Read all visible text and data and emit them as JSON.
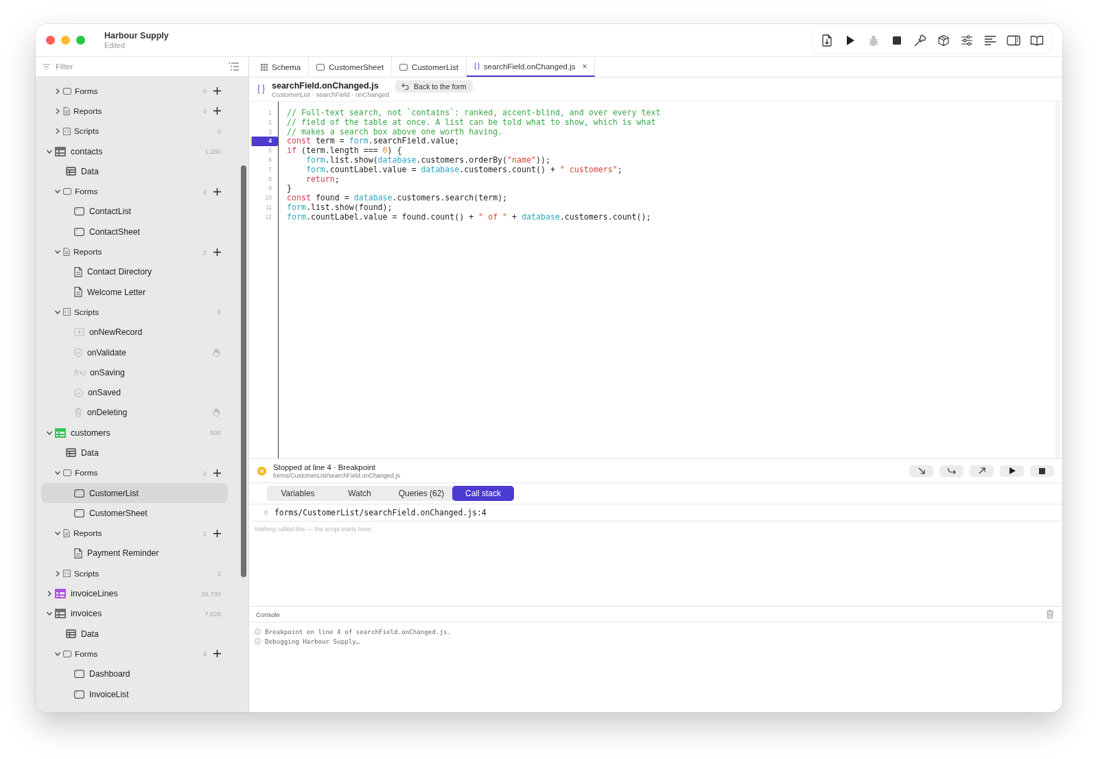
{
  "window": {
    "title": "Harbour Supply",
    "subtitle": "Edited"
  },
  "sidebar": {
    "filter": {
      "placeholder": "Filter"
    },
    "items": [
      {
        "kind": "forms",
        "label": "Forms",
        "count": "0",
        "expanded": false,
        "selected": false
      },
      {
        "kind": "reports",
        "label": "Reports",
        "count": "0",
        "expanded": false,
        "selected": false
      },
      {
        "kind": "scripts",
        "label": "Scripts",
        "count": "0",
        "expanded": false,
        "selected": false
      },
      {
        "kind": "table",
        "label": "contacts",
        "count": "1.280",
        "color": "#6e6e73",
        "expanded": true,
        "selected": false,
        "children": [
          {
            "kind": "data",
            "label": "Data",
            "selected": false
          },
          {
            "kind": "forms",
            "label": "Forms",
            "count": "2",
            "expanded": true,
            "selected": false,
            "children": [
              {
                "kind": "form",
                "label": "ContactList",
                "selected": false
              },
              {
                "kind": "form",
                "label": "ContactSheet",
                "selected": false
              }
            ]
          },
          {
            "kind": "reports",
            "label": "Reports",
            "count": "2",
            "expanded": true,
            "selected": false,
            "children": [
              {
                "kind": "report",
                "label": "Contact Directory",
                "selected": false
              },
              {
                "kind": "report",
                "label": "Welcome Letter",
                "selected": false
              }
            ]
          },
          {
            "kind": "scripts",
            "label": "Scripts",
            "count": "0",
            "expanded": true,
            "selected": false,
            "children": [
              {
                "kind": "insert",
                "label": "onNewRecord",
                "hand": false,
                "selected": false
              },
              {
                "kind": "validate",
                "label": "onValidate",
                "hand": true,
                "selected": false
              },
              {
                "kind": "formula",
                "glyph": "f(x)",
                "label": "onSaving",
                "hand": false,
                "selected": false
              },
              {
                "kind": "saved",
                "label": "onSaved",
                "hand": false,
                "selected": false
              },
              {
                "kind": "delete",
                "label": "onDeleting",
                "hand": true,
                "selected": false
              }
            ]
          }
        ]
      },
      {
        "kind": "table",
        "label": "customers",
        "count": "500",
        "color": "#34c759",
        "expanded": true,
        "selected": false,
        "children": [
          {
            "kind": "data",
            "label": "Data",
            "selected": false
          },
          {
            "kind": "forms",
            "label": "Forms",
            "count": "2",
            "expanded": true,
            "selected": false,
            "children": [
              {
                "kind": "form",
                "label": "CustomerList",
                "selected": true
              },
              {
                "kind": "form",
                "label": "CustomerSheet",
                "selected": false
              }
            ]
          },
          {
            "kind": "reports",
            "label": "Reports",
            "count": "1",
            "expanded": true,
            "selected": false,
            "children": [
              {
                "kind": "report",
                "label": "Payment Reminder",
                "selected": false
              }
            ]
          },
          {
            "kind": "scripts",
            "label": "Scripts",
            "count": "2",
            "expanded": false,
            "selected": false
          }
        ]
      },
      {
        "kind": "table",
        "label": "invoiceLines",
        "count": "26.730",
        "color": "#af52de",
        "expanded": false,
        "selected": false
      },
      {
        "kind": "table",
        "label": "invoices",
        "count": "7.628",
        "color": "#6e6e73",
        "expanded": true,
        "selected": false,
        "children": [
          {
            "kind": "data",
            "label": "Data",
            "selected": false
          },
          {
            "kind": "forms",
            "label": "Forms",
            "count": "3",
            "expanded": true,
            "selected": false,
            "children": [
              {
                "kind": "form",
                "label": "Dashboard",
                "selected": false
              },
              {
                "kind": "form",
                "label": "InvoiceList",
                "selected": false
              }
            ]
          }
        ]
      }
    ]
  },
  "tabs": [
    {
      "kind": "schema",
      "label": "Schema",
      "selected": false
    },
    {
      "kind": "form",
      "label": "CustomerSheet",
      "selected": false
    },
    {
      "kind": "form",
      "label": "CustomerList",
      "selected": false
    },
    {
      "kind": "script",
      "label": "searchField.onChanged.js",
      "close": "×",
      "selected": true
    }
  ],
  "editor": {
    "title": "searchField.onChanged.js",
    "subtitle": "CustomerList · searchField · onChanged",
    "back_button": "Back to the form",
    "lines": [
      {
        "number": "1",
        "breakpoint": false,
        "indented": false,
        "tokens": [
          {
            "kind": "comment",
            "text": "// Full-text search, not `contains`: ranked, accent-blind, and over every text"
          }
        ]
      },
      {
        "number": "2",
        "breakpoint": false,
        "indented": false,
        "tokens": [
          {
            "kind": "comment",
            "text": "// field of the table at once. A list can be told what to show, which is what"
          }
        ]
      },
      {
        "number": "3",
        "breakpoint": false,
        "indented": false,
        "tokens": [
          {
            "kind": "comment",
            "text": "// makes a search box above one worth having."
          }
        ]
      },
      {
        "number": "4",
        "breakpoint": true,
        "indented": false,
        "tokens": [
          {
            "kind": "keyword",
            "text": "const"
          },
          {
            "kind": "plain",
            "text": " term = "
          },
          {
            "kind": "object",
            "text": "form"
          },
          {
            "kind": "plain",
            "text": ".searchField.value;"
          }
        ]
      },
      {
        "number": "5",
        "breakpoint": false,
        "indented": false,
        "tokens": [
          {
            "kind": "keyword",
            "text": "if"
          },
          {
            "kind": "plain",
            "text": " (term.length === "
          },
          {
            "kind": "number",
            "text": "0"
          },
          {
            "kind": "plain",
            "text": ") {"
          }
        ]
      },
      {
        "number": "6",
        "breakpoint": false,
        "indented": true,
        "tokens": [
          {
            "kind": "object",
            "text": "form"
          },
          {
            "kind": "plain",
            "text": ".list.show("
          },
          {
            "kind": "object",
            "text": "database"
          },
          {
            "kind": "plain",
            "text": ".customers.orderBy("
          },
          {
            "kind": "string",
            "text": "\"name\""
          },
          {
            "kind": "plain",
            "text": "));"
          }
        ]
      },
      {
        "number": "7",
        "breakpoint": false,
        "indented": true,
        "tokens": [
          {
            "kind": "object",
            "text": "form"
          },
          {
            "kind": "plain",
            "text": ".countLabel.value = "
          },
          {
            "kind": "object",
            "text": "database"
          },
          {
            "kind": "plain",
            "text": ".customers.count() + "
          },
          {
            "kind": "string",
            "text": "\" customers\""
          },
          {
            "kind": "plain",
            "text": ";"
          }
        ]
      },
      {
        "number": "8",
        "breakpoint": false,
        "indented": true,
        "tokens": [
          {
            "kind": "keyword",
            "text": "return"
          },
          {
            "kind": "plain",
            "text": ";"
          }
        ]
      },
      {
        "number": "9",
        "breakpoint": false,
        "indented": false,
        "tokens": [
          {
            "kind": "plain",
            "text": "}"
          }
        ]
      },
      {
        "number": "10",
        "breakpoint": false,
        "indented": false,
        "tokens": [
          {
            "kind": "keyword",
            "text": "const"
          },
          {
            "kind": "plain",
            "text": " found = "
          },
          {
            "kind": "object",
            "text": "database"
          },
          {
            "kind": "plain",
            "text": ".customers.search(term);"
          }
        ]
      },
      {
        "number": "11",
        "breakpoint": false,
        "indented": false,
        "tokens": [
          {
            "kind": "object",
            "text": "form"
          },
          {
            "kind": "plain",
            "text": ".list.show(found);"
          }
        ]
      },
      {
        "number": "12",
        "breakpoint": false,
        "indented": false,
        "tokens": [
          {
            "kind": "object",
            "text": "form"
          },
          {
            "kind": "plain",
            "text": ".countLabel.value = found.count() + "
          },
          {
            "kind": "string",
            "text": "\" of \""
          },
          {
            "kind": "plain",
            "text": " + "
          },
          {
            "kind": "object",
            "text": "database"
          },
          {
            "kind": "plain",
            "text": ".customers.count();"
          }
        ]
      }
    ]
  },
  "debugger": {
    "status": "Stopped at line 4 · Breakpoint",
    "path": "forms/CustomerList/searchField.onChanged.js",
    "tabs": [
      {
        "label": "Variables",
        "selected": false
      },
      {
        "label": "Watch",
        "selected": false
      },
      {
        "label": "Queries (62)",
        "selected": false
      },
      {
        "label": "Call stack",
        "selected": true
      }
    ],
    "frames": [
      {
        "index": "0",
        "location": "forms/CustomerList/searchField.onChanged.js:4"
      }
    ],
    "note": "Nothing called this — the script starts here."
  },
  "console": {
    "title": "Console",
    "messages": [
      "Breakpoint on line 4 of searchField.onChanged.js.",
      "Debugging Harbour Supply…"
    ]
  }
}
